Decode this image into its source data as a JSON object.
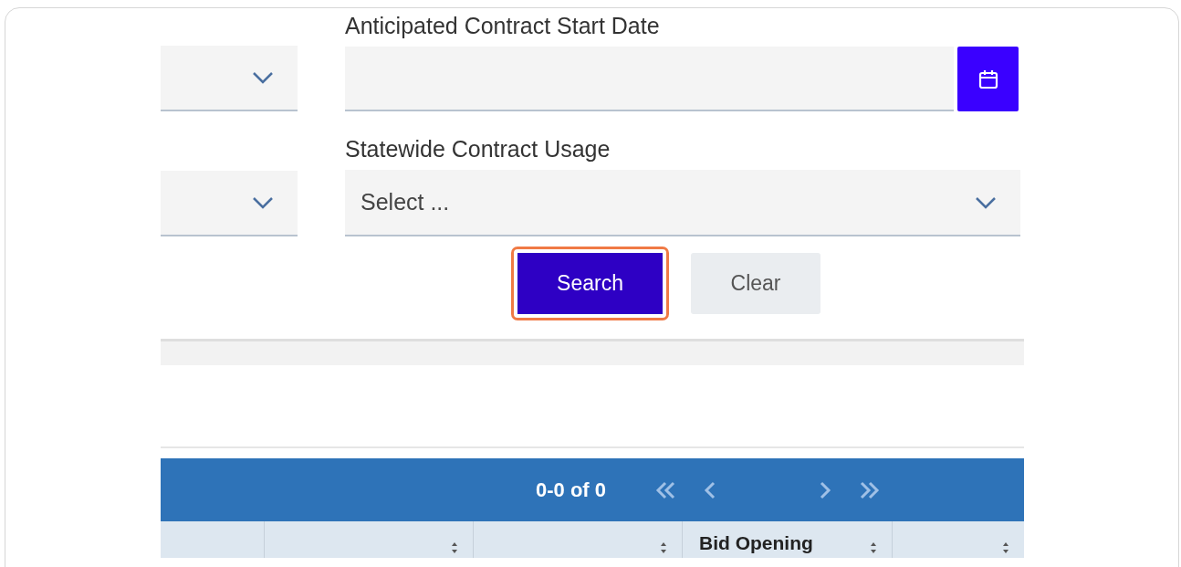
{
  "date_field": {
    "label": "Anticipated Contract Start Date"
  },
  "usage_field": {
    "label": "Statewide Contract Usage",
    "placeholder": "Select ..."
  },
  "buttons": [
    {
      "label": "Search",
      "kind": "primary",
      "focused": true
    },
    {
      "label": "Clear",
      "kind": "secondary",
      "focused": false
    }
  ],
  "pager": {
    "range": "0-0 of 0"
  },
  "table": {
    "columns": [
      "",
      "",
      "",
      "Bid Opening",
      ""
    ]
  }
}
